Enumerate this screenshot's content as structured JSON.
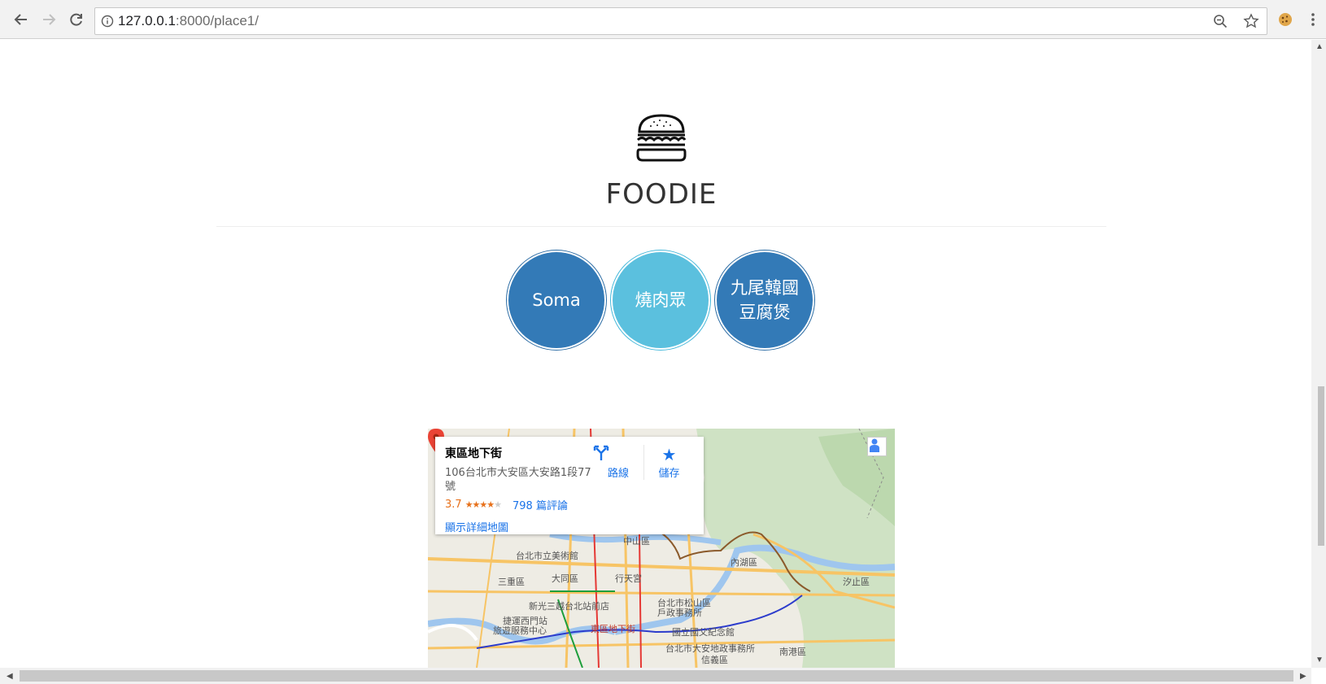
{
  "browser": {
    "url_host": "127.0.0.1",
    "url_path": ":8000/place1/",
    "icons": [
      "back-icon",
      "forward-icon",
      "reload-icon",
      "info-icon",
      "zoom-out-icon",
      "bookmark-star-icon",
      "cookie-extension-icon",
      "menu-dots-icon"
    ]
  },
  "site": {
    "title": "FOODIE",
    "logo_icon": "burger-icon"
  },
  "places": [
    {
      "label": "Soma",
      "color": "#337ab7"
    },
    {
      "label": "燒肉眾",
      "color": "#5bc0de"
    },
    {
      "label": "九尾韓國\n豆腐煲",
      "color": "#337ab7"
    }
  ],
  "map": {
    "card": {
      "name": "東區地下街",
      "address": "106台北市大安區大安路1段77號",
      "rating": "3.7",
      "reviews": "798 篇評論",
      "detail_link": "顯示詳細地圖",
      "directions_label": "路線",
      "save_label": "儲存"
    },
    "labels": [
      {
        "text": "台北市立美術館"
      },
      {
        "text": "大同區"
      },
      {
        "text": "三重區"
      },
      {
        "text": "行天宮"
      },
      {
        "text": "內湖區"
      },
      {
        "text": "汐止區"
      },
      {
        "text": "新光三越台北站前店"
      },
      {
        "text": "捷運西門站"
      },
      {
        "text": "旅遊服務中心"
      },
      {
        "text": "東區地下街"
      },
      {
        "text": "台北市松山區"
      },
      {
        "text": "戶政事務所"
      },
      {
        "text": "國立國父紀念館"
      },
      {
        "text": "台北市大安地政事務所"
      },
      {
        "text": "南港區"
      },
      {
        "text": "中山區"
      },
      {
        "text": "信義區"
      }
    ]
  }
}
